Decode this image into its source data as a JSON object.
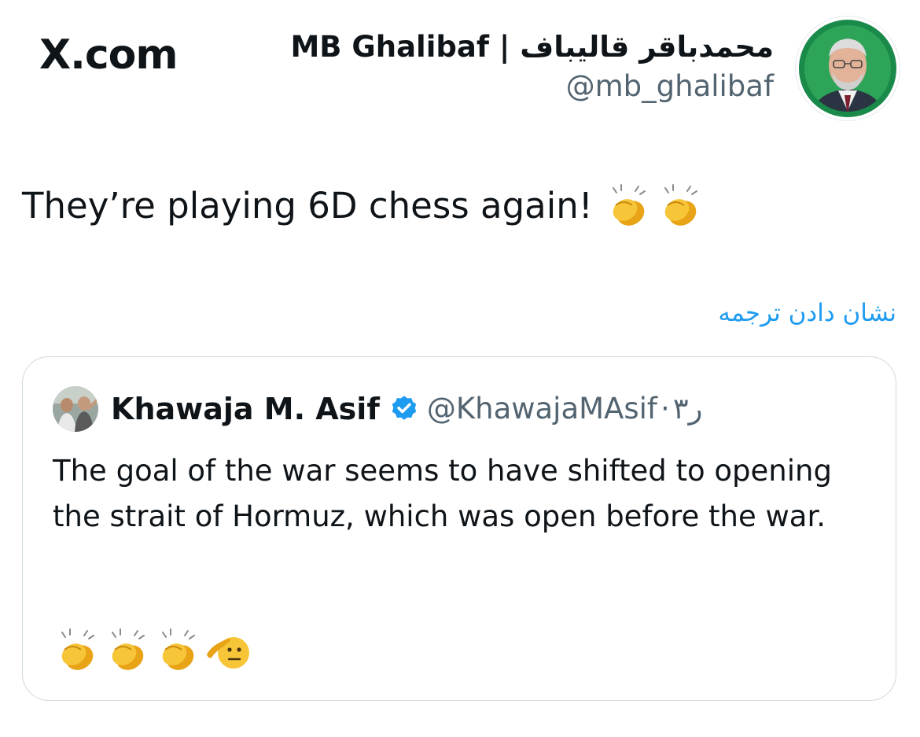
{
  "header": {
    "site_logo": "X.com"
  },
  "author": {
    "name": "MB Ghalibaf | محمدباقر قالیباف",
    "handle": "@mb_ghalibaf",
    "avatar_icon": "profile-photo"
  },
  "tweet": {
    "text": "They’re playing 6D chess again!",
    "emojis": [
      "clapping-hands-icon",
      "clapping-hands-icon"
    ]
  },
  "translate": {
    "label": "نشان دادن ترجمه"
  },
  "quoted_tweet": {
    "author_name": "Khawaja M. Asif",
    "verified": true,
    "handle": "@KhawajaMAsif",
    "separator": "·",
    "time": "۳ر",
    "text": "The goal of the war seems to have shifted to opening the strait of Hormuz, which was open before the war.",
    "emojis": [
      "clapping-hands-icon",
      "clapping-hands-icon",
      "clapping-hands-icon",
      "saluting-face-icon"
    ]
  },
  "colors": {
    "text_primary": "#0f1419",
    "text_secondary": "#536471",
    "link": "#1d9bf0",
    "verified": "#1d9bf0",
    "border": "#cfd9de",
    "avatar_ring": "#1a8a4a"
  }
}
